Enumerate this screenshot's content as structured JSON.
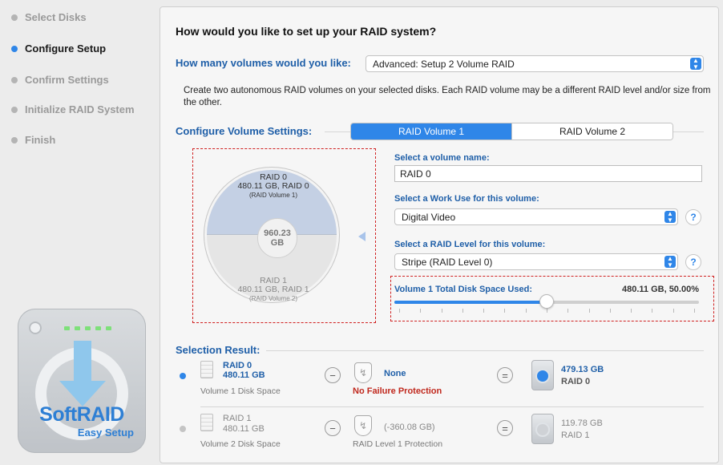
{
  "steps": [
    {
      "label": "Select Disks",
      "active": false
    },
    {
      "label": "Configure Setup",
      "active": true
    },
    {
      "label": "Confirm Settings",
      "active": false
    },
    {
      "label": "Initialize RAID System",
      "active": false
    },
    {
      "label": "Finish",
      "active": false
    }
  ],
  "logo": {
    "title": "SoftRAID",
    "subtitle": "Easy Setup"
  },
  "main": {
    "heading": "How would you like to set up your RAID system?",
    "volumes_label": "How many volumes would you like:",
    "volumes_value": "Advanced: Setup 2 Volume RAID",
    "description": "Create two autonomous RAID volumes on your selected disks. Each RAID volume may be a different RAID level and/or size from the other.",
    "config_label": "Configure Volume Settings:",
    "tabs": [
      "RAID Volume 1",
      "RAID Volume 2"
    ],
    "pie": {
      "top": {
        "line1": "RAID 0",
        "line2": "480.11 GB, RAID 0",
        "line3": "(RAID Volume 1)"
      },
      "bottom": {
        "line1": "RAID 1",
        "line2": "480.11 GB, RAID 1",
        "line3": "(RAID Volume 2)"
      },
      "center_value": "960.23",
      "center_unit": "GB",
      "split_fraction": 0.5
    },
    "volume_name_label": "Select a volume name:",
    "volume_name_value": "RAID 0",
    "work_use_label": "Select a Work Use for this volume:",
    "work_use_value": "Digital Video",
    "raid_level_label": "Select a RAID Level for this volume:",
    "raid_level_value": "Stripe (RAID Level 0)",
    "help_symbol": "?",
    "slider_label": "Volume 1 Total Disk Space Used:",
    "slider_value_text": "480.11 GB, 50.00%",
    "slider_fraction": 0.5
  },
  "result": {
    "label": "Selection Result:",
    "rows": [
      {
        "raid": "RAID 0",
        "size": "480.11 GB",
        "caption": "Volume 1 Disk Space",
        "minus": "−",
        "protection_value": "None",
        "protection_caption": "No Failure Protection",
        "equals": "=",
        "result_size": "479.13 GB",
        "result_raid": "RAID 0"
      },
      {
        "raid": "RAID 1",
        "size": "480.11 GB",
        "caption": "Volume 2 Disk Space",
        "minus": "−",
        "protection_value": "(-360.08 GB)",
        "protection_caption": "RAID Level 1 Protection",
        "equals": "=",
        "result_size": "119.78 GB",
        "result_raid": "RAID 1"
      }
    ]
  },
  "colors": {
    "accent": "#2f86e8",
    "label_blue": "#1f5fa8",
    "warning_red": "#c0281d"
  }
}
